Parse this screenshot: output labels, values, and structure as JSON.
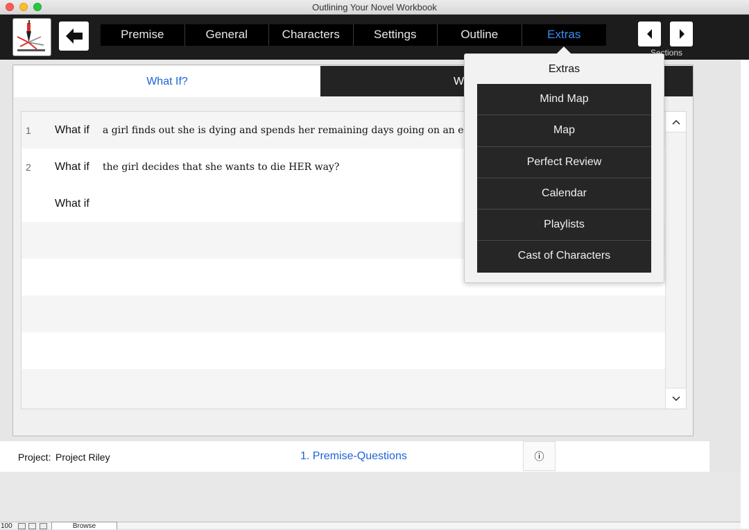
{
  "window": {
    "title": "Outlining Your Novel Workbook"
  },
  "toolbar": {
    "nav": [
      "Premise",
      "General",
      "Characters",
      "Settings",
      "Outline",
      "Extras"
    ],
    "active_nav": "Extras",
    "sections_label": "Sections"
  },
  "tabs": {
    "left": "What If?",
    "right": "W"
  },
  "rows": [
    {
      "num": "1",
      "label": "What if",
      "text": "a girl finds out she is dying and spends her remaining days going on an epic road t"
    },
    {
      "num": "2",
      "label": "What if",
      "text": "the girl decides that she wants to die HER way?"
    },
    {
      "num": "",
      "label": "What if",
      "text": ""
    }
  ],
  "status": {
    "project_label": "Project:",
    "project_name": "Project Riley",
    "layout_link": "1. Premise-Questions",
    "info_glyph": "ⓘ"
  },
  "footer": {
    "zoom": "100",
    "browse": "Browse"
  },
  "popover": {
    "title": "Extras",
    "items": [
      "Mind Map",
      "Map",
      "Perfect Review",
      "Calendar",
      "Playlists",
      "Cast of Characters"
    ]
  },
  "colors": {
    "accent": "#1d62d6",
    "nav_active": "#3d8df5",
    "toolbar_bg": "#1c1c1c",
    "logo_red": "#d9302a"
  }
}
